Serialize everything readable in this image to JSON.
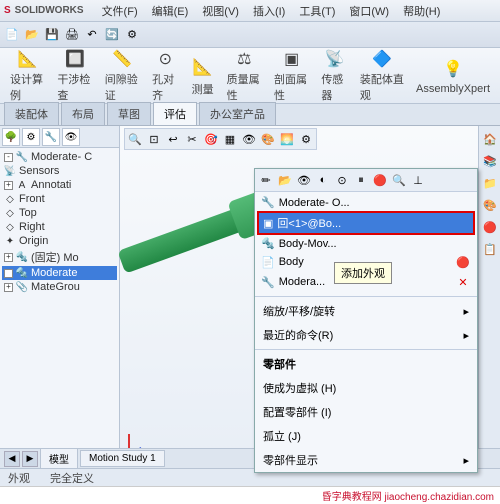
{
  "title": {
    "logo_prefix": "S",
    "logo_text": "SOLIDWORKS"
  },
  "menu": [
    "文件(F)",
    "编辑(E)",
    "视图(V)",
    "插入(I)",
    "工具(T)",
    "窗口(W)",
    "帮助(H)"
  ],
  "ribbon": {
    "items": [
      {
        "label": "设计算例",
        "icon": "📐"
      },
      {
        "label": "干涉检查",
        "icon": "🔲"
      },
      {
        "label": "间隙验证",
        "icon": "📏"
      },
      {
        "label": "孔对齐",
        "icon": "⊙"
      },
      {
        "label": "测量",
        "icon": "📐"
      },
      {
        "label": "质量属性",
        "icon": "⚖"
      },
      {
        "label": "剖面属性",
        "icon": "▣"
      },
      {
        "label": "传感器",
        "icon": "📡"
      },
      {
        "label": "装配体直观",
        "icon": "🔷"
      },
      {
        "label": "AssemblyXpert",
        "icon": "💡"
      }
    ]
  },
  "tabs": [
    "装配体",
    "布局",
    "草图",
    "评估",
    "办公室产品"
  ],
  "active_tab": "评估",
  "tree": {
    "items": [
      {
        "label": "Moderate- C",
        "icon": "🔧",
        "expand": "-"
      },
      {
        "label": "Sensors",
        "icon": "📡",
        "expand": ""
      },
      {
        "label": "Annotati",
        "icon": "A",
        "expand": "+"
      },
      {
        "label": "Front",
        "icon": "◇",
        "expand": ""
      },
      {
        "label": "Top",
        "icon": "◇",
        "expand": ""
      },
      {
        "label": "Right",
        "icon": "◇",
        "expand": ""
      },
      {
        "label": "Origin",
        "icon": "✦",
        "expand": ""
      },
      {
        "label": "(固定) Mo",
        "icon": "🔩",
        "expand": "+"
      },
      {
        "label": "Moderate",
        "icon": "🔩",
        "expand": "+",
        "sel": true
      },
      {
        "label": "MateGrou",
        "icon": "📎",
        "expand": "+"
      }
    ]
  },
  "context": {
    "list": [
      {
        "label": "Moderate- O...",
        "icon": "🔧"
      },
      {
        "label": "回<1>@Bo...",
        "icon": "▣",
        "hl": true
      },
      {
        "label": "Body-Mov...",
        "icon": "🔩"
      },
      {
        "label": "Body",
        "icon": "📄"
      },
      {
        "label": "Modera...",
        "icon": "🔧"
      }
    ],
    "menu": [
      "缩放/平移/旋转",
      "最近的命令(R)",
      "零部件",
      "使成为虚拟 (H)",
      "配置零部件 (I)",
      "孤立 (J)",
      "零部件显示"
    ],
    "tooltip": "添加外观"
  },
  "bottom_tabs": [
    "模型",
    "Motion Study 1"
  ],
  "status": {
    "left": "外观",
    "center": "完全定义"
  },
  "watermark": "昏字典教程网 jiaocheng.chazidian.com"
}
